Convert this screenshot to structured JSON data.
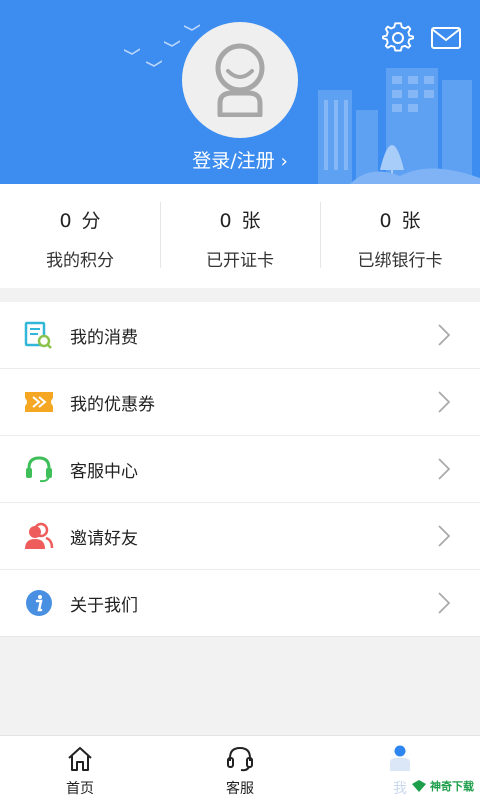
{
  "header": {
    "login_label": "登录/注册",
    "chevron": "›",
    "settings_icon": "gear-icon",
    "mail_icon": "mail-icon",
    "avatar_icon": "default-avatar-icon",
    "bg_color": "#3d8df0"
  },
  "stats": [
    {
      "value": "0",
      "unit": "分",
      "label": "我的积分"
    },
    {
      "value": "0",
      "unit": "张",
      "label": "已开证卡"
    },
    {
      "value": "0",
      "unit": "张",
      "label": "已绑银行卡"
    }
  ],
  "menu": [
    {
      "label": "我的消费",
      "icon": "receipt-icon",
      "color": "#33b7d8"
    },
    {
      "label": "我的优惠券",
      "icon": "coupon-icon",
      "color": "#f5a623"
    },
    {
      "label": "客服中心",
      "icon": "headset-icon",
      "color": "#3fbf5a"
    },
    {
      "label": "邀请好友",
      "icon": "invite-friend-icon",
      "color": "#ef5c5c"
    },
    {
      "label": "关于我们",
      "icon": "info-icon",
      "color": "#4a90e2"
    }
  ],
  "tabs": [
    {
      "label": "首页",
      "icon": "home-icon",
      "active": false
    },
    {
      "label": "客服",
      "icon": "headset-icon",
      "active": false
    },
    {
      "label": "我",
      "icon": "user-icon",
      "active": true
    }
  ],
  "watermark": {
    "label": "神奇下载"
  }
}
